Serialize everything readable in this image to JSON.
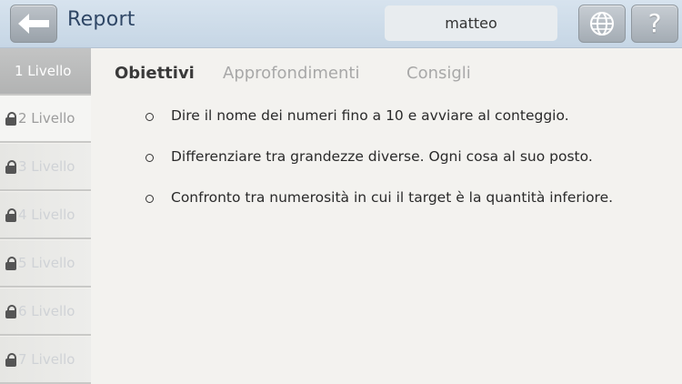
{
  "header": {
    "title": "Report",
    "username": "matteo",
    "help_label": "?"
  },
  "sidebar": {
    "levels": [
      {
        "label": "1 Livello",
        "state": "active"
      },
      {
        "label": "2 Livello",
        "state": "unlocked"
      },
      {
        "label": "3 Livello",
        "state": "locked"
      },
      {
        "label": "4 Livello",
        "state": "locked"
      },
      {
        "label": "5 Livello",
        "state": "locked"
      },
      {
        "label": "6 Livello",
        "state": "locked"
      },
      {
        "label": "7 Livello",
        "state": "locked"
      }
    ]
  },
  "tabs": [
    {
      "label": "Obiettivi",
      "active": true
    },
    {
      "label": "Approfondimenti",
      "active": false
    },
    {
      "label": "Consigli",
      "active": false
    }
  ],
  "objectives": [
    "Dire il nome dei numeri fino a 10 e avviare al conteggio.",
    "Differenziare tra grandezze diverse. Ogni cosa al suo posto.",
    "Confronto tra numerosità in cui il target è la quantità inferiore."
  ],
  "icons": {
    "back": "arrow-left-icon",
    "globe": "globe-icon",
    "help": "question-icon",
    "lock": "lock-icon"
  },
  "colors": {
    "header_bg": "#cddbe8",
    "title": "#2f4766",
    "active_tab": "#3a3a3a",
    "inactive_tab": "#a8a8a8"
  }
}
